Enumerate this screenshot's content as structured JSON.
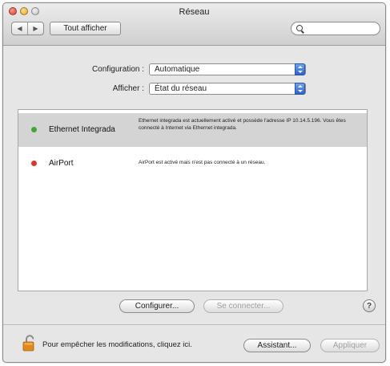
{
  "window": {
    "title": "Réseau"
  },
  "toolbar": {
    "back_glyph": "◀",
    "forward_glyph": "▶",
    "show_all_label": "Tout afficher",
    "search_value": ""
  },
  "settings": {
    "configuration_label": "Configuration :",
    "configuration_value": "Automatique",
    "show_label": "Afficher :",
    "show_value": "État du réseau"
  },
  "services": [
    {
      "name": "Ethernet Integrada",
      "status_color": "#3fa83a",
      "description": "Ethernet integrada est actuellement activé et possède l'adresse IP 10.14.5.196. Vous êtes connecté à Internet via Ethernet integrada."
    },
    {
      "name": "AirPort",
      "status_color": "#d93a30",
      "description": "AirPort est activé mais n'est pas connecté à un réseau."
    }
  ],
  "actions": {
    "configure_label": "Configurer...",
    "connect_label": "Se connecter...",
    "help_label": "?"
  },
  "footer": {
    "lock_text": "Pour empêcher les modifications, cliquez ici.",
    "assistant_label": "Assistant...",
    "apply_label": "Appliquer"
  },
  "icons": {
    "lock": "lock-icon",
    "search": "search-icon",
    "help": "help-icon"
  }
}
